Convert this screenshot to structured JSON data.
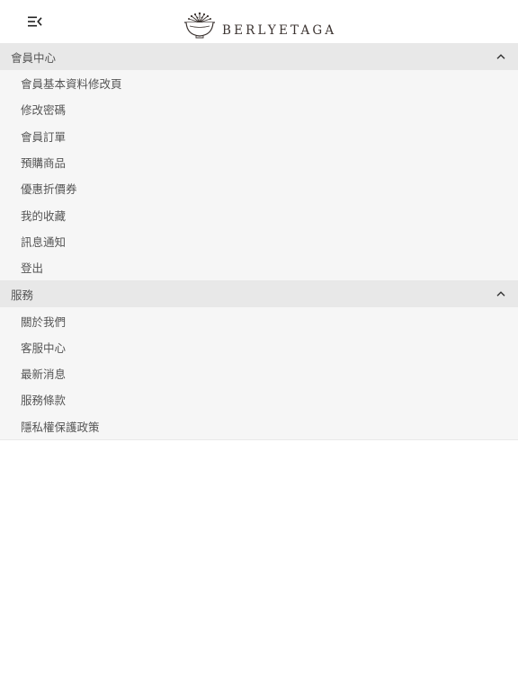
{
  "header": {
    "menu_icon": "menu-collapse-icon",
    "logo_icon": "bowl-logo-icon",
    "brand": "BERLYETAGA"
  },
  "menu": {
    "sections": [
      {
        "title": "會員中心",
        "icon": "chevron-up-icon",
        "items": [
          "會員基本資料修改頁",
          "修改密碼",
          "會員訂單",
          "預購商品",
          "優惠折價券",
          "我的收藏",
          "訊息通知",
          "登出"
        ]
      },
      {
        "title": "服務",
        "icon": "chevron-up-icon",
        "items": [
          "關於我們",
          "客服中心",
          "最新消息",
          "服務條款",
          "隱私權保護政策"
        ]
      }
    ]
  }
}
